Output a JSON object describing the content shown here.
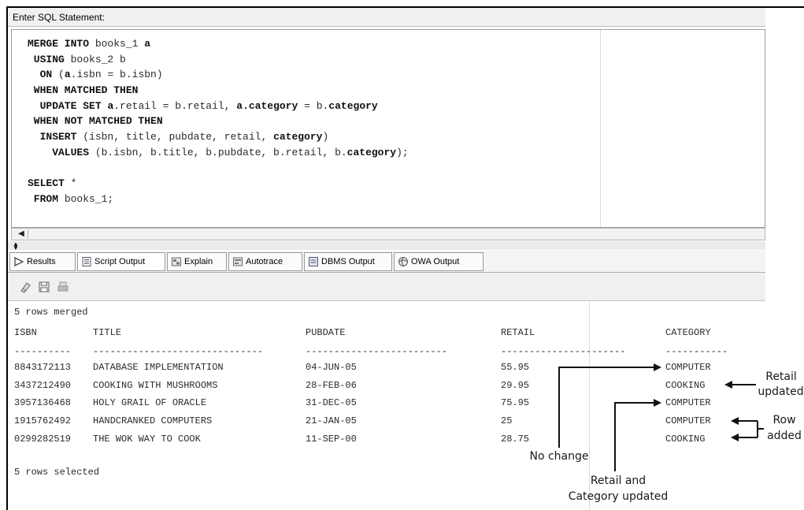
{
  "prompt_label": "Enter SQL Statement:",
  "editor": {
    "lines": [
      [
        {
          "t": "MERGE INTO",
          "b": true
        },
        {
          "t": " books_1 "
        },
        {
          "t": "a",
          "b": true
        }
      ],
      [
        {
          "t": " USING",
          "b": true
        },
        {
          "t": " books_2 b"
        }
      ],
      [
        {
          "t": "  ON",
          "b": true
        },
        {
          "t": " ("
        },
        {
          "t": "a",
          "b": true
        },
        {
          "t": ".isbn = b.isbn)"
        }
      ],
      [
        {
          "t": " WHEN MATCHED THEN",
          "b": true
        }
      ],
      [
        {
          "t": "  UPDATE SET",
          "b": true
        },
        {
          "t": " "
        },
        {
          "t": "a",
          "b": true
        },
        {
          "t": ".retail = b.retail, "
        },
        {
          "t": "a.category",
          "b": true
        },
        {
          "t": " = b."
        },
        {
          "t": "category",
          "b": true
        }
      ],
      [
        {
          "t": " WHEN NOT MATCHED THEN",
          "b": true
        }
      ],
      [
        {
          "t": "  INSERT",
          "b": true
        },
        {
          "t": " (isbn, title, pubdate, retail, "
        },
        {
          "t": "category",
          "b": true
        },
        {
          "t": ")"
        }
      ],
      [
        {
          "t": "    VALUES",
          "b": true
        },
        {
          "t": " (b.isbn, b.title, b.pubdate, b.retail, b."
        },
        {
          "t": "category",
          "b": true
        },
        {
          "t": ");"
        }
      ],
      [
        {
          "t": ""
        }
      ],
      [
        {
          "t": "SELECT",
          "b": true
        },
        {
          "t": " *"
        }
      ],
      [
        {
          "t": " FROM",
          "b": true
        },
        {
          "t": " books_1;"
        }
      ]
    ]
  },
  "tabs": [
    {
      "label": "Results",
      "icon": "play-icon"
    },
    {
      "label": "Script Output",
      "icon": "script-icon"
    },
    {
      "label": "Explain",
      "icon": "explain-icon"
    },
    {
      "label": "Autotrace",
      "icon": "autotrace-icon"
    },
    {
      "label": "DBMS Output",
      "icon": "dbms-icon"
    },
    {
      "label": "OWA Output",
      "icon": "owa-icon"
    }
  ],
  "toolbar": {
    "icons": [
      "eraser-icon",
      "save-icon",
      "print-icon"
    ]
  },
  "output": {
    "header_message": "5 rows merged",
    "columns": [
      "ISBN",
      "TITLE",
      "PUBDATE",
      "RETAIL",
      "CATEGORY"
    ],
    "separators": [
      "----------",
      "------------------------------",
      "-------------------------",
      "----------------------",
      "-----------"
    ],
    "rows": [
      [
        "8843172113",
        "DATABASE IMPLEMENTATION",
        "04-JUN-05",
        "55.95",
        "COMPUTER"
      ],
      [
        "3437212490",
        "COOKING WITH MUSHROOMS",
        "28-FEB-06",
        "29.95",
        "COOKING"
      ],
      [
        "3957136468",
        "HOLY GRAIL OF ORACLE",
        "31-DEC-05",
        "75.95",
        "COMPUTER"
      ],
      [
        "1915762492",
        "HANDCRANKED COMPUTERS",
        "21-JAN-05",
        "25",
        "COMPUTER"
      ],
      [
        "0299282519",
        "THE WOK WAY TO COOK",
        "11-SEP-00",
        "28.75",
        "COOKING"
      ]
    ],
    "footer_message": "5 rows selected"
  },
  "annotations": {
    "no_change": "No change",
    "retail_and_category_1": "Retail and",
    "retail_and_category_2": "Category updated",
    "retail_updated_1": "Retail",
    "retail_updated_2": "updated",
    "row_added_1": "Row",
    "row_added_2": "added"
  }
}
